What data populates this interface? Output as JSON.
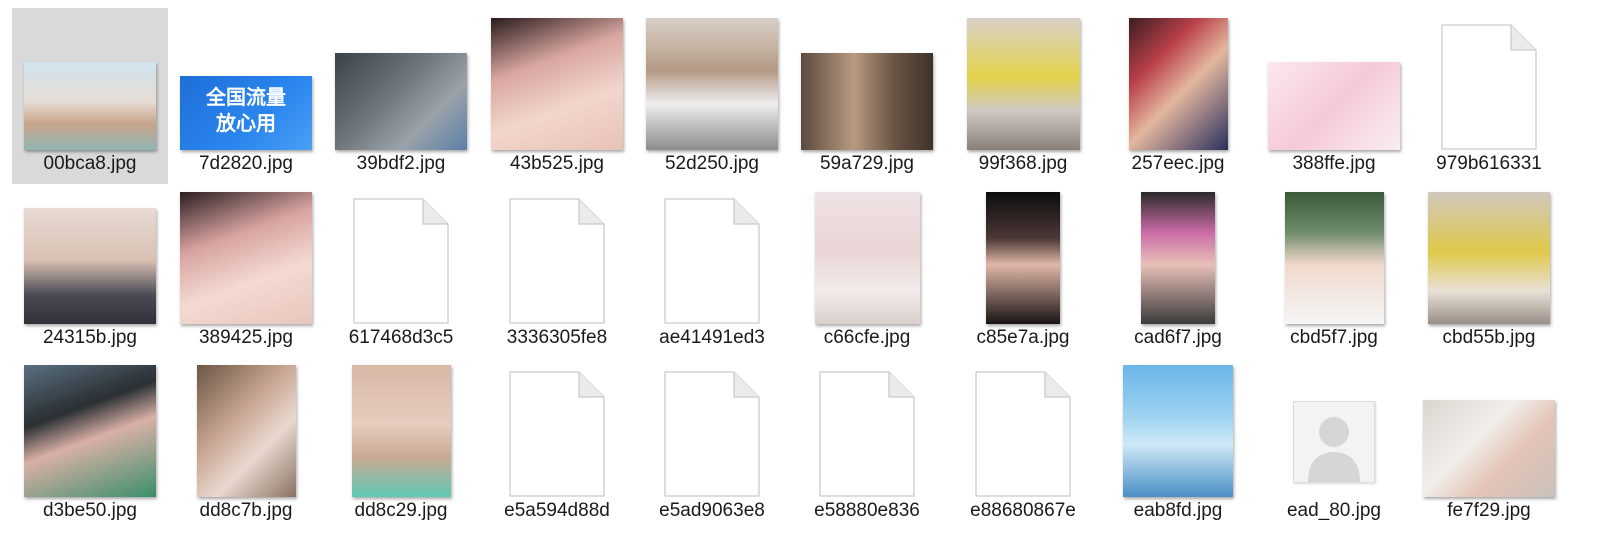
{
  "files": [
    {
      "name": "00bca8.jpg",
      "kind": "photo",
      "w": 132,
      "h": 88,
      "selected": true,
      "bg": "linear-gradient(180deg,#cfe3ef 0%,#e6dcd4 45%,#c9a58b 70%,#8fb6b3 100%)"
    },
    {
      "name": "7d2820.jpg",
      "kind": "photo",
      "w": 132,
      "h": 74,
      "bg": "linear-gradient(135deg,#1f6fd8 0%,#2a86ee 60%,#4aa0f5 100%)",
      "overlay": "全国流量 放心用"
    },
    {
      "name": "39bdf2.jpg",
      "kind": "photo",
      "w": 132,
      "h": 97,
      "bg": "linear-gradient(135deg,#3a4248 0%,#6b7379 40%,#9aa3a9 70%,#5b7fa8 100%)"
    },
    {
      "name": "43b525.jpg",
      "kind": "photo",
      "w": 132,
      "h": 132,
      "bg": "linear-gradient(160deg,#2a1c1c 0%,#d9a6a0 35%,#f2d6cc 65%,#e8c2b6 100%)"
    },
    {
      "name": "52d250.jpg",
      "kind": "photo",
      "w": 132,
      "h": 132,
      "bg": "linear-gradient(180deg,#d8d0c6 0%,#b49a86 40%,#eeeeee 65%,#8c8c8c 100%)"
    },
    {
      "name": "59a729.jpg",
      "kind": "photo",
      "w": 132,
      "h": 97,
      "bg": "linear-gradient(90deg,#5b4a3f 0%,#b89a7f 40%,#6b5646 70%,#3f3129 100%)"
    },
    {
      "name": "99f368.jpg",
      "kind": "photo",
      "w": 113,
      "h": 132,
      "bg": "linear-gradient(180deg,#d9d1c8 0%,#e3d24a 45%,#cfc9c4 70%,#8a8078 100%)"
    },
    {
      "name": "257eec.jpg",
      "kind": "photo",
      "w": 99,
      "h": 132,
      "bg": "linear-gradient(135deg,#3a1e20 0%,#b9404a 30%,#e3b79e 55%,#2a2f5e 100%)"
    },
    {
      "name": "388ffe.jpg",
      "kind": "photo",
      "w": 132,
      "h": 88,
      "bg": "linear-gradient(135deg,#fbe8ef 0%,#f6c9d7 50%,#f9eef2 100%)"
    },
    {
      "name": "979b616331",
      "kind": "file",
      "w": 96,
      "h": 126
    },
    {
      "name": "24315b.jpg",
      "kind": "photo",
      "w": 132,
      "h": 116,
      "bg": "linear-gradient(180deg,#e7dbd3 0%,#d9c0b3 45%,#4a4b55 75%,#2f3038 100%)"
    },
    {
      "name": "389425.jpg",
      "kind": "photo",
      "w": 132,
      "h": 132,
      "bg": "linear-gradient(160deg,#2b1f21 0%,#d8a3a0 35%,#f4dad2 65%,#e7c5bc 100%)"
    },
    {
      "name": "617468d3c5",
      "kind": "file",
      "w": 96,
      "h": 126
    },
    {
      "name": "3336305fe8",
      "kind": "file",
      "w": 96,
      "h": 126
    },
    {
      "name": "ae41491ed3",
      "kind": "file",
      "w": 96,
      "h": 126
    },
    {
      "name": "c66cfe.jpg",
      "kind": "photo",
      "w": 105,
      "h": 132,
      "bg": "linear-gradient(180deg,#efe2e4 0%,#e9d5d6 45%,#f2ecea 75%,#d9d0cd 100%)"
    },
    {
      "name": "c85e7a.jpg",
      "kind": "photo",
      "w": 74,
      "h": 132,
      "bg": "linear-gradient(180deg,#0d0d0d 0%,#4a3735 35%,#e0b7a8 55%,#1a1414 100%)"
    },
    {
      "name": "cad6f7.jpg",
      "kind": "photo",
      "w": 74,
      "h": 132,
      "bg": "linear-gradient(180deg,#2a2a2a 0%,#c86aa4 30%,#e8c0b8 55%,#3a3a3a 100%)"
    },
    {
      "name": "cbd5f7.jpg",
      "kind": "photo",
      "w": 99,
      "h": 132,
      "bg": "linear-gradient(180deg,#3b5a3a 0%,#6d8a6a 30%,#f0d8cc 55%,#f6f6f6 100%)"
    },
    {
      "name": "cbd55b.jpg",
      "kind": "photo",
      "w": 122,
      "h": 132,
      "bg": "linear-gradient(180deg,#cfc7bd 0%,#e0c94a 45%,#e8e0d6 75%,#9a8f86 100%)"
    },
    {
      "name": "d3be50.jpg",
      "kind": "photo",
      "w": 132,
      "h": 132,
      "bg": "linear-gradient(160deg,#5a7080 0%,#2a2f33 35%,#d9b0a6 55%,#3a8f6a 100%)"
    },
    {
      "name": "dd8c7b.jpg",
      "kind": "photo",
      "w": 99,
      "h": 132,
      "bg": "linear-gradient(135deg,#6c5644 0%,#c9a694 40%,#e9d8cf 65%,#8a7262 100%)"
    },
    {
      "name": "dd8c29.jpg",
      "kind": "photo",
      "w": 99,
      "h": 132,
      "bg": "linear-gradient(180deg,#d8b8a6 0%,#e7cdbf 45%,#c9a993 70%,#5fc9b4 100%)"
    },
    {
      "name": "e5a594d88d",
      "kind": "file",
      "w": 96,
      "h": 126
    },
    {
      "name": "e5ad9063e8",
      "kind": "file",
      "w": 96,
      "h": 126
    },
    {
      "name": "e58880e836",
      "kind": "file",
      "w": 96,
      "h": 126
    },
    {
      "name": "e88680867e",
      "kind": "file",
      "w": 96,
      "h": 126
    },
    {
      "name": "eab8fd.jpg",
      "kind": "photo",
      "w": 110,
      "h": 132,
      "bg": "linear-gradient(180deg,#6bb6e8 0%,#9fd3f0 40%,#cfe9f7 60%,#4a8fc6 100%)"
    },
    {
      "name": "ead_80.jpg",
      "kind": "person",
      "w": 80,
      "h": 80
    },
    {
      "name": "fe7f29.jpg",
      "kind": "photo",
      "w": 132,
      "h": 97,
      "bg": "linear-gradient(135deg,#d9d5cf 0%,#f2eeea 40%,#e3c3b6 65%,#c9c2bb 100%)"
    }
  ]
}
